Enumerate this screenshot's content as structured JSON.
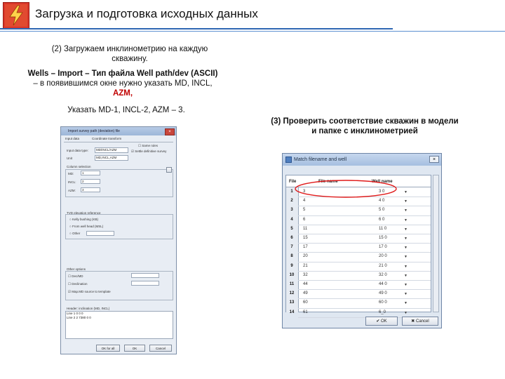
{
  "slide": {
    "title": "Загрузка и подготовка исходных данных",
    "step2_line1": "(2) Загружаем инклинометрию на каждую",
    "step2_line2": "скважину.",
    "wells_line1": "Wells – Import – Тип файла Well path/dev (ASCII)",
    "wells_line2": "– в появившимся окне нужно указать MD, INCL,",
    "wells_line3": "AZM,",
    "indicate": "Указать MD-1, INCL-2, AZM – 3.",
    "step3_line1": "(3) Проверить соответствие скважин в модели",
    "step3_line2": "и папке с инклинометрией",
    "accent_color": "#c00000",
    "rule_color": "#2f67b3"
  },
  "import_dialog": {
    "title": "Import survey path (deviation) file",
    "tabs": [
      "Input data",
      "Coordinate transform"
    ],
    "file_type_label": "Input data type:",
    "file_type_value": "MD/INCL/AZM",
    "unit_label": "Unit",
    "unit_value": "MD,INCL,AZM",
    "columns_label": "Column selection",
    "md_label": "MD:",
    "md_value": "1",
    "incl_label": "INCL:",
    "incl_value": "2",
    "azm_label": "AZM:",
    "azm_value": "3",
    "checkbox_same": "Same rules",
    "checkbox_settle": "Settle definitive survey",
    "tvd_group": "TVD elevation reference",
    "tvd_options": [
      "Kelly bushing (KB)",
      "From well head (MSL)",
      "Other"
    ],
    "other_group": "Other options",
    "other_opts": [
      "Dec/MD",
      "Declination",
      "Map.MD source to template"
    ],
    "preview_header": "Header: inclination (MD, INCL)",
    "preview_rows": [
      "Line 1    0    0    0",
      "Line 2    2  7380    0    0"
    ],
    "ok_all": "OK for all",
    "ok": "OK",
    "cancel": "Cancel"
  },
  "match_dialog": {
    "title": "Match filename and well",
    "col_file": "File",
    "col_filename": "File name",
    "col_wellname": "Well name",
    "rows": [
      {
        "n": "1",
        "file": "3",
        "well": "3 0"
      },
      {
        "n": "2",
        "file": "4",
        "well": "4 0"
      },
      {
        "n": "3",
        "file": "5",
        "well": "5 0"
      },
      {
        "n": "4",
        "file": "6",
        "well": "6 0"
      },
      {
        "n": "5",
        "file": "11",
        "well": "11 0"
      },
      {
        "n": "6",
        "file": "15",
        "well": "15 0"
      },
      {
        "n": "7",
        "file": "17",
        "well": "17 0"
      },
      {
        "n": "8",
        "file": "20",
        "well": "20 0"
      },
      {
        "n": "9",
        "file": "21",
        "well": "21 0"
      },
      {
        "n": "10",
        "file": "32",
        "well": "32 0"
      },
      {
        "n": "11",
        "file": "44",
        "well": "44 0"
      },
      {
        "n": "12",
        "file": "49",
        "well": "49 0"
      },
      {
        "n": "13",
        "file": "60",
        "well": "60 0"
      },
      {
        "n": "14",
        "file": "61",
        "well": "6_0"
      }
    ],
    "ok": "OK",
    "cancel": "Cancel"
  }
}
